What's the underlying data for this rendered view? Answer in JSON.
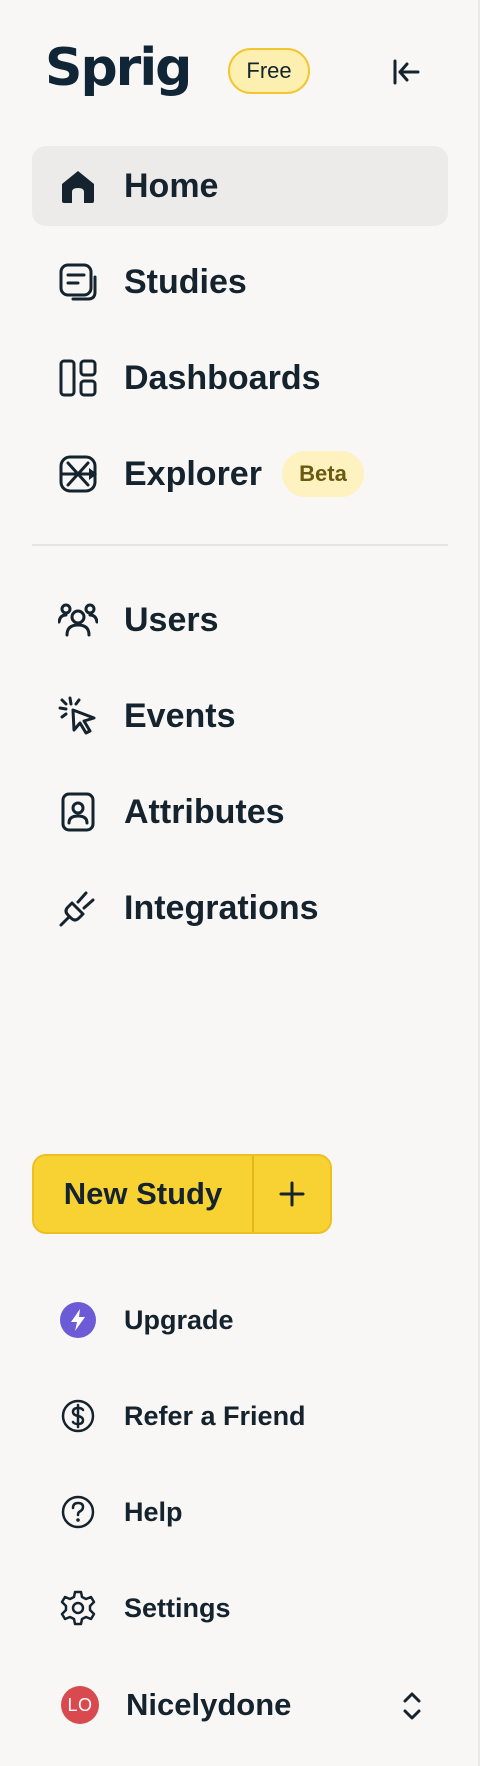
{
  "brand": {
    "logo_text": "Sprig",
    "plan_badge": "Free"
  },
  "nav": {
    "primary": [
      {
        "label": "Home",
        "icon": "home-icon",
        "active": true
      },
      {
        "label": "Studies",
        "icon": "studies-icon"
      },
      {
        "label": "Dashboards",
        "icon": "dashboards-icon"
      },
      {
        "label": "Explorer",
        "icon": "explorer-icon",
        "badge": "Beta"
      }
    ],
    "secondary": [
      {
        "label": "Users",
        "icon": "users-icon"
      },
      {
        "label": "Events",
        "icon": "events-icon"
      },
      {
        "label": "Attributes",
        "icon": "attributes-icon"
      },
      {
        "label": "Integrations",
        "icon": "integrations-icon"
      }
    ]
  },
  "actions": {
    "new_study_label": "New Study",
    "plus_icon": "plus-icon"
  },
  "utility": [
    {
      "label": "Upgrade",
      "icon": "bolt-icon"
    },
    {
      "label": "Refer a Friend",
      "icon": "dollar-circle-icon"
    },
    {
      "label": "Help",
      "icon": "help-icon"
    },
    {
      "label": "Settings",
      "icon": "gear-icon"
    }
  ],
  "account": {
    "initials": "LO",
    "name": "Nicelydone"
  },
  "colors": {
    "sidebar_bg": "#f8f7f5",
    "active_item_bg": "#ecebea",
    "primary_yellow": "#f8d233",
    "upgrade_purple": "#6b5bd6",
    "avatar_red": "#d94a4f",
    "text_dark": "#14232d"
  }
}
